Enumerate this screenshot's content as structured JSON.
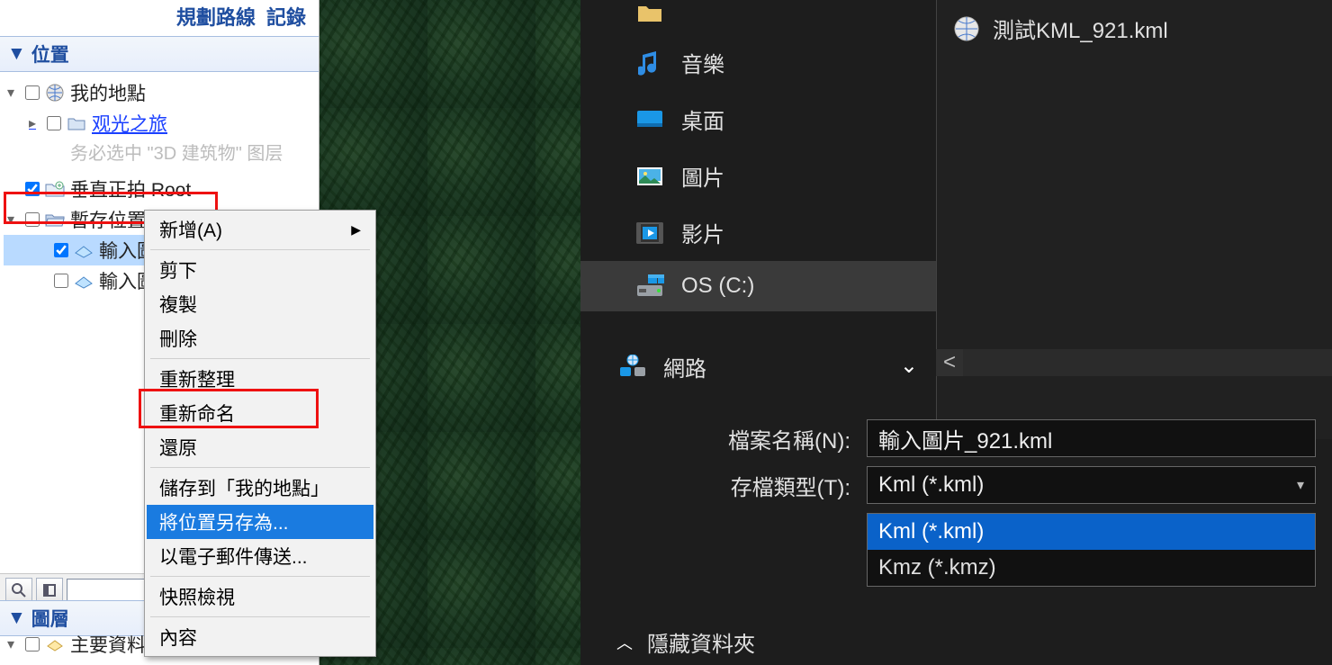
{
  "left": {
    "top_links": {
      "route": "規劃路線",
      "record": "記錄"
    },
    "places_header": "位置",
    "tree": {
      "my_places": "我的地點",
      "tour": "观光之旅",
      "hint": "务必选中 \"3D 建筑物\" 图层",
      "vertical": "垂直正拍 Root",
      "temp": "暫存位置",
      "input1": "輸入圖片",
      "input2": "輸入圖"
    },
    "layers_header": "圖層",
    "layers_root": "主要資料庫",
    "context_menu": {
      "new": "新增(A)",
      "cut": "剪下",
      "copy": "複製",
      "delete": "刪除",
      "refresh": "重新整理",
      "rename": "重新命名",
      "revert": "還原",
      "save_my": "儲存到「我的地點」",
      "save_as": "將位置另存為...",
      "email": "以電子郵件傳送...",
      "snapshot": "快照檢視",
      "props": "內容"
    }
  },
  "right": {
    "nav": {
      "music": "音樂",
      "desktop": "桌面",
      "pictures": "圖片",
      "videos": "影片",
      "osc": "OS (C:)",
      "network": "網路"
    },
    "file": "測試KML_921.kml",
    "filename_label": "檔案名稱(N):",
    "filename_value": "輸入圖片_921.kml",
    "filetype_label": "存檔類型(T):",
    "filetype_value": "Kml (*.kml)",
    "options": {
      "kml": "Kml (*.kml)",
      "kmz": "Kmz (*.kmz)"
    },
    "hide_folder": "隱藏資料夾"
  }
}
